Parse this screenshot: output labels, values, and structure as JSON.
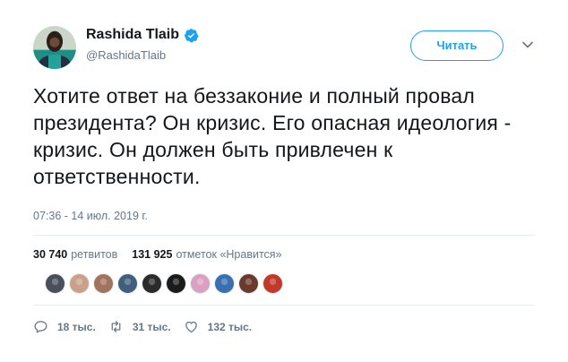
{
  "author": {
    "display_name": "Rashida Tlaib",
    "handle": "@RashidaTlaib",
    "verified": true
  },
  "follow_button": {
    "label": "Читать"
  },
  "tweet": {
    "text": "Хотите ответ на беззаконие и полный провал президента? Он кризис. Его опасная идеология - кризис. Он должен быть привлечен к ответственности.",
    "timestamp": "07:36 - 14 июл. 2019 г."
  },
  "stats": {
    "retweets_count": "30 740",
    "retweets_label": "ретвитов",
    "likes_count": "131 925",
    "likes_label": "отметок «Нравится»"
  },
  "liker_colors": [
    "#4a4f5a",
    "#c9a18b",
    "#a3735d",
    "#3f5f7a",
    "#2b2b2b",
    "#1b1b1b",
    "#d9a0c0",
    "#3a6fb0",
    "#6a3a2a",
    "#c0392b"
  ],
  "actions": {
    "replies": "18 тыс.",
    "retweets": "31 тыс.",
    "likes": "132 тыс."
  },
  "colors": {
    "accent": "#1da1f2",
    "muted": "#657786"
  }
}
